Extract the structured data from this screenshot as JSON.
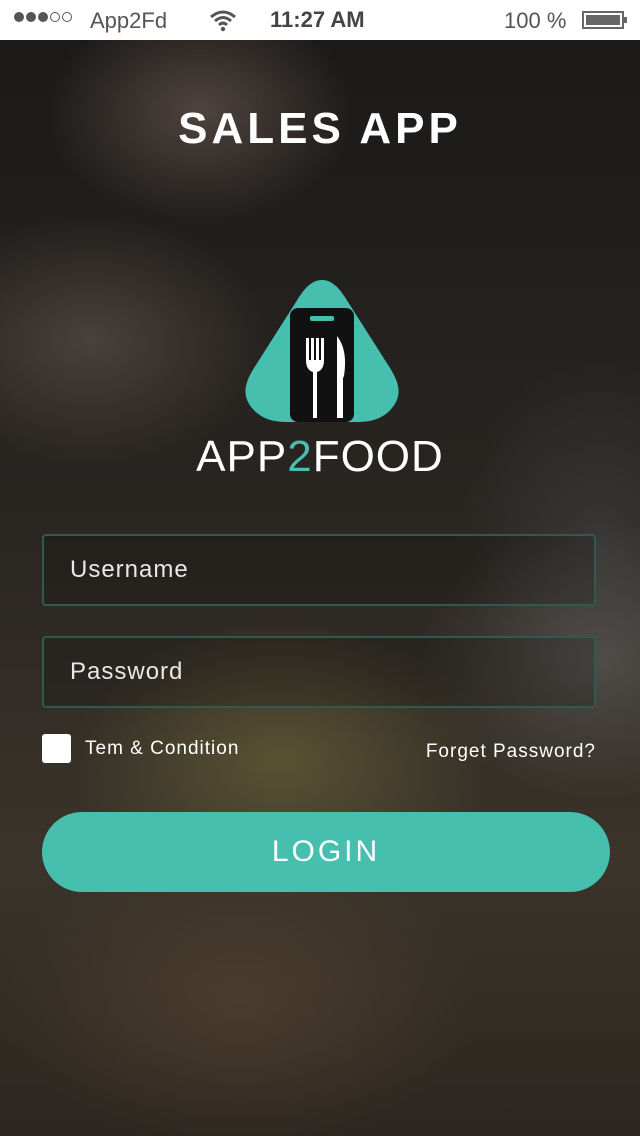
{
  "status_bar": {
    "carrier": "App2Fd",
    "time": "11:27 AM",
    "battery": "100 %",
    "signal_bars_filled": 3,
    "signal_bars_total": 5
  },
  "app": {
    "title": "SALES APP",
    "brand_part1": "APP",
    "brand_accent": "2",
    "brand_part2": "FOOD"
  },
  "form": {
    "username_placeholder": "Username",
    "password_placeholder": "Password",
    "terms_label": "Tem & Condition",
    "forgot_label": "Forget Password?",
    "login_label": "LOGIN"
  },
  "colors": {
    "accent": "#46bfae",
    "field_border": "#2f5a52"
  },
  "icons": {
    "logo": "phone-fork-knife-icon",
    "wifi": "wifi-icon",
    "battery": "battery-icon"
  }
}
